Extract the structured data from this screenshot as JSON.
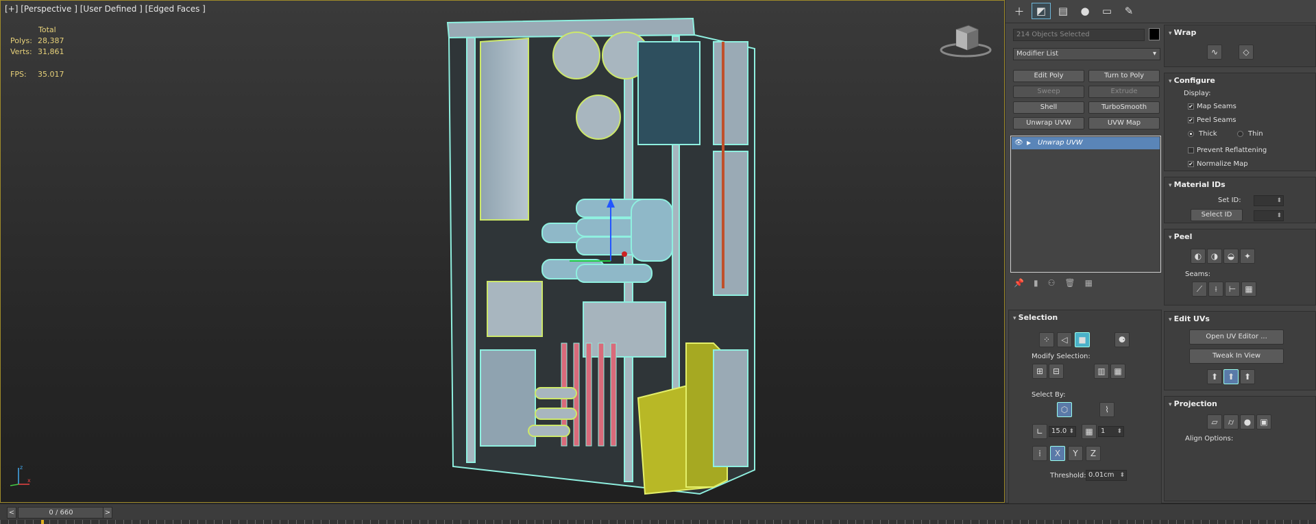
{
  "viewport": {
    "label": "[+] [Perspective ] [User Defined ] [Edged Faces ]",
    "stats": {
      "header": "Total",
      "polys_label": "Polys:",
      "polys_value": "28,387",
      "verts_label": "Verts:",
      "verts_value": "31,861",
      "fps_label": "FPS:",
      "fps_value": "35.017"
    }
  },
  "command_panel": {
    "tabs": [
      "create-icon",
      "modify-icon",
      "hierarchy-icon",
      "motion-icon",
      "display-icon",
      "utilities-icon"
    ],
    "selection_field": "214 Objects Selected",
    "modifier_list": "Modifier List",
    "buttons": [
      "Edit Poly",
      "Turn to Poly",
      "Sweep",
      "Extrude",
      "Shell",
      "TurboSmooth",
      "Unwrap UVW",
      "UVW Map"
    ],
    "stack_item": "Unwrap UVW"
  },
  "selection": {
    "title": "Selection",
    "modify_label": "Modify Selection:",
    "select_by_label": "Select By:",
    "angle_value": "15.0",
    "count_value": "1",
    "threshold_label": "Threshold:",
    "threshold_value": "0.01cm",
    "axis_letters": [
      "X",
      "Y",
      "Z"
    ]
  },
  "wrap": {
    "title": "Wrap"
  },
  "configure": {
    "title": "Configure",
    "display_label": "Display:",
    "map_seams": "Map Seams",
    "peel_seams": "Peel Seams",
    "thick": "Thick",
    "thin": "Thin",
    "prevent": "Prevent Reflattening",
    "normalize": "Normalize Map"
  },
  "material_ids": {
    "title": "Material IDs",
    "set_id": "Set ID:",
    "select_id": "Select ID"
  },
  "peel": {
    "title": "Peel",
    "seams_label": "Seams:"
  },
  "edit_uvs": {
    "title": "Edit UVs",
    "open_editor": "Open UV Editor ...",
    "tweak": "Tweak In View"
  },
  "projection": {
    "title": "Projection",
    "align_options": "Align Options:"
  },
  "timeline": {
    "frame": "0 / 660",
    "prev": "<",
    "next": ">"
  }
}
